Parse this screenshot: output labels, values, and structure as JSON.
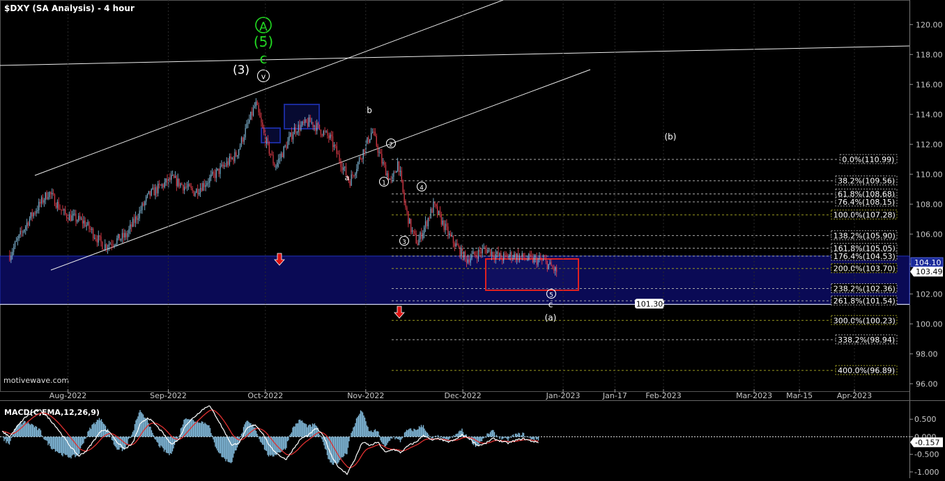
{
  "title": "$DXY (SA Analysis) - 4 hour",
  "watermark": "motivewave.com",
  "colors": {
    "background": "#000000",
    "zone": "#0a0a55",
    "zone_line": "#2233bb",
    "box_red": "#e02020",
    "box_blue": "#1a2a9a",
    "fib_gray": "#aaaaaa",
    "fib_olive": "#9a9a20",
    "wave_green": "#22dd22",
    "arrow_red": "#dd1111",
    "macd_hist": "#7fb6d6",
    "macd_line": "#ffffff",
    "signal_line": "#e03030"
  },
  "chart_data": [
    {
      "type": "candlestick",
      "title": "$DXY (SA Analysis) - 4 hour",
      "ylim": [
        95.5,
        121.5
      ],
      "y_ticks": [
        "120.00",
        "118.00",
        "116.00",
        "114.00",
        "112.00",
        "110.00",
        "108.00",
        "106.00",
        "104.00",
        "102.00",
        "100.00",
        "98.00",
        "96.00"
      ],
      "x_labels": [
        "Aug-2022",
        "Sep-2022",
        "Oct-2022",
        "Nov-2022",
        "Dec-2022",
        "Jan-2023",
        "Jan-17",
        "Feb-2023",
        "Mar-2023",
        "Mar-15",
        "Apr-2023"
      ],
      "price_path": [
        [
          "2022-07-14",
          104.6
        ],
        [
          "2022-07-20",
          107.0
        ],
        [
          "2022-07-26",
          108.8
        ],
        [
          "2022-07-31",
          107.3
        ],
        [
          "2022-08-06",
          106.8
        ],
        [
          "2022-08-12",
          105.2
        ],
        [
          "2022-08-19",
          105.9
        ],
        [
          "2022-08-26",
          108.6
        ],
        [
          "2022-09-02",
          109.7
        ],
        [
          "2022-09-09",
          108.8
        ],
        [
          "2022-09-15",
          109.9
        ],
        [
          "2022-09-22",
          111.3
        ],
        [
          "2022-09-28",
          114.7
        ],
        [
          "2022-10-01",
          112.3
        ],
        [
          "2022-10-04",
          110.5
        ],
        [
          "2022-10-10",
          113.0
        ],
        [
          "2022-10-15",
          113.5
        ],
        [
          "2022-10-21",
          112.4
        ],
        [
          "2022-10-27",
          109.5
        ],
        [
          "2022-11-03",
          112.9
        ],
        [
          "2022-11-06",
          110.8
        ],
        [
          "2022-11-09",
          109.4
        ],
        [
          "2022-11-11",
          110.9
        ],
        [
          "2022-11-13",
          108.0
        ],
        [
          "2022-11-15",
          106.3
        ],
        [
          "2022-11-17",
          105.4
        ],
        [
          "2022-11-22",
          107.9
        ],
        [
          "2022-11-27",
          105.8
        ],
        [
          "2022-12-02",
          104.3
        ],
        [
          "2022-12-08",
          105.0
        ],
        [
          "2022-12-13",
          104.4
        ],
        [
          "2022-12-16",
          104.6
        ],
        [
          "2022-12-22",
          104.3
        ],
        [
          "2022-12-26",
          104.2
        ],
        [
          "2022-12-30",
          103.49
        ]
      ],
      "last_price": "103.49",
      "zone_top_label": "104.10",
      "zone_low": 101.3,
      "target_label": "101.30",
      "fib_levels": [
        {
          "label": "0.0%(110.99)",
          "value": 110.99,
          "color": "gray"
        },
        {
          "label": "38.2%(109.56)",
          "value": 109.56,
          "color": "gray"
        },
        {
          "label": "61.8%(108.68)",
          "value": 108.68,
          "color": "gray"
        },
        {
          "label": "76.4%(108.15)",
          "value": 108.15,
          "color": "gray"
        },
        {
          "label": "100.0%(107.28)",
          "value": 107.28,
          "color": "olive"
        },
        {
          "label": "138.2%(105.90)",
          "value": 105.9,
          "color": "gray"
        },
        {
          "label": "161.8%(105.05)",
          "value": 105.05,
          "color": "gray"
        },
        {
          "label": "176.4%(104.53)",
          "value": 104.53,
          "color": "gray"
        },
        {
          "label": "200.0%(103.70)",
          "value": 103.7,
          "color": "olive"
        },
        {
          "label": "238.2%(102.36)",
          "value": 102.36,
          "color": "gray"
        },
        {
          "label": "261.8%(101.54)",
          "value": 101.54,
          "color": "gray"
        },
        {
          "label": "300.0%(100.23)",
          "value": 100.23,
          "color": "olive"
        },
        {
          "label": "338.2%(98.94)",
          "value": 98.94,
          "color": "gray"
        },
        {
          "label": "400.0%(96.89)",
          "value": 96.89,
          "color": "olive"
        }
      ],
      "wave_labels": [
        {
          "text": "A",
          "color": "green",
          "circled": true
        },
        {
          "text": "(5)",
          "color": "green"
        },
        {
          "text": "c",
          "color": "green"
        },
        {
          "text": "(3)",
          "color": "white"
        },
        {
          "text": "v",
          "color": "white",
          "circled": true
        },
        {
          "text": "b",
          "color": "white"
        },
        {
          "text": "a",
          "color": "white"
        },
        {
          "text": "2",
          "color": "white",
          "circled": true
        },
        {
          "text": "1",
          "color": "white",
          "circled": true
        },
        {
          "text": "4",
          "color": "white",
          "circled": true
        },
        {
          "text": "3",
          "color": "white",
          "circled": true
        },
        {
          "text": "5",
          "color": "white",
          "circled": true
        },
        {
          "text": "c",
          "color": "white"
        },
        {
          "text": "(a)",
          "color": "white"
        },
        {
          "text": "(b)",
          "color": "white"
        }
      ]
    },
    {
      "type": "line",
      "title": "MACD(C,EMA,12,26,9)",
      "ylim": [
        -1.1,
        1.0
      ],
      "y_ticks": [
        "0.500",
        "0.000",
        "-0.500",
        "-1.000"
      ],
      "last_value": "-0.157",
      "series": [
        {
          "name": "MACD",
          "values": [
            0.15,
            0.0,
            0.3,
            0.55,
            0.7,
            0.75,
            0.55,
            0.3,
            0.0,
            -0.3,
            -0.55,
            -0.4,
            -0.1,
            0.2,
            0.15,
            -0.15,
            -0.35,
            -0.2,
            0.35,
            0.55,
            0.35,
            0.1,
            -0.2,
            -0.1,
            0.35,
            0.55,
            0.75,
            0.9,
            0.55,
            0.15,
            -0.25,
            -0.15,
            0.25,
            0.35,
            0.1,
            -0.3,
            -0.5,
            -0.65,
            -0.35,
            -0.05,
            0.05,
            0.25,
            0.0,
            -0.55,
            -0.9,
            -1.05,
            -0.65,
            -0.15,
            -0.25,
            -0.15,
            -0.45,
            -0.35,
            -0.45,
            -0.25,
            -0.15,
            0.05,
            -0.1,
            -0.05,
            -0.15,
            -0.1,
            0.05,
            -0.05,
            -0.25,
            -0.2,
            -0.05,
            -0.12,
            -0.18,
            -0.1,
            -0.05,
            -0.12,
            -0.157
          ]
        }
      ]
    }
  ]
}
